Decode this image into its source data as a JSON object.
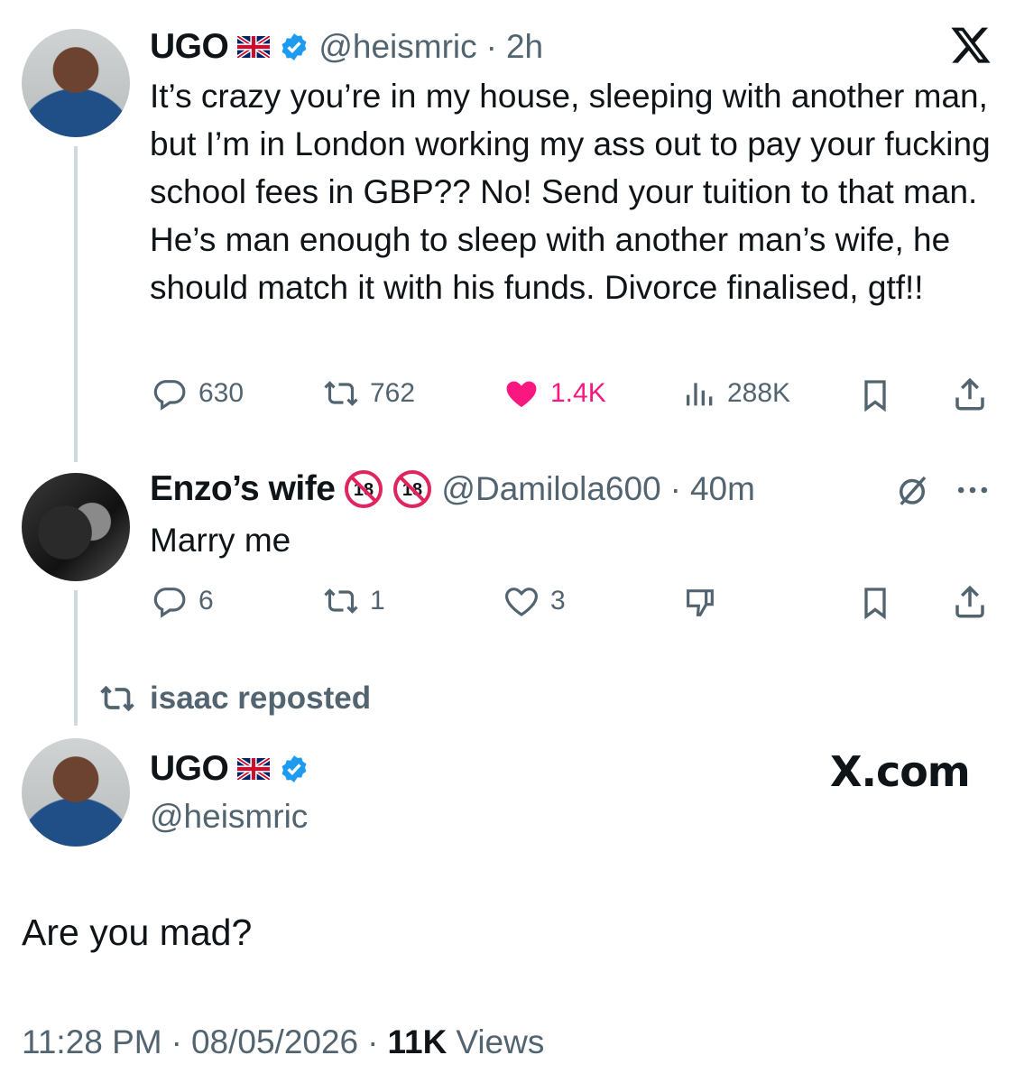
{
  "tweet1": {
    "name": "UGO",
    "handle": "@heismric",
    "dot": "·",
    "time": "2h",
    "text": "It’s crazy you’re in my house, sleeping with another man, but I’m in London working my ass out to pay your fucking school fees in GBP?? No! Send your tuition to that man. He’s man enough to sleep with another man’s wife, he should match it with his funds. Divorce finalised, gtf!!",
    "replies": "630",
    "reposts": "762",
    "likes": "1.4K",
    "views": "288K"
  },
  "tweet2": {
    "name": "Enzo’s wife",
    "badge": "18",
    "handle": "@Damilola600",
    "dot": "·",
    "time": "40m",
    "text": "Marry me",
    "replies": "6",
    "reposts": "1",
    "likes": "3"
  },
  "repost_bar": {
    "label": "isaac reposted"
  },
  "tweet3": {
    "name": "UGO",
    "handle": "@heismric",
    "site": "X.com",
    "text": "Are you mad?",
    "time": "11:28 PM",
    "dot1": "·",
    "date": "08/05/2026",
    "dot2": "·",
    "views_count": "11K",
    "views_label": "Views"
  },
  "colors": {
    "text": "#0f1419",
    "muted": "#536471",
    "like_pink": "#f91880",
    "verified_blue": "#1d9bf0",
    "thread_line": "#cfd9de"
  },
  "icons": [
    "x-logo-icon",
    "reply-icon",
    "repost-icon",
    "heart-icon",
    "views-icon",
    "bookmark-icon",
    "share-icon",
    "grok-icon",
    "more-icon",
    "dislike-icon",
    "verified-icon",
    "uk-flag-icon",
    "no-18-icon"
  ]
}
